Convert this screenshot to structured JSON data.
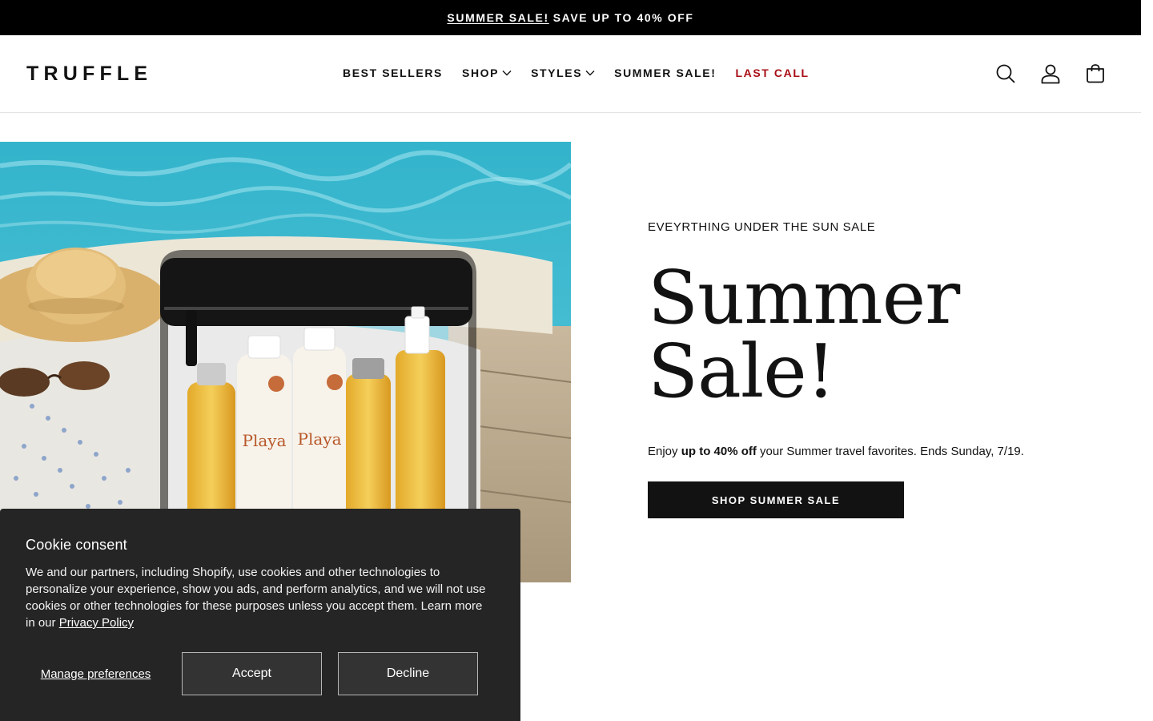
{
  "announcement": {
    "link_text": "SUMMER SALE!",
    "text": "SAVE UP TO 40% OFF"
  },
  "header": {
    "logo": "TRUFFLE",
    "nav": [
      {
        "label": "BEST SELLERS"
      },
      {
        "label": "SHOP"
      },
      {
        "label": "STYLES"
      },
      {
        "label": "SUMMER SALE!"
      },
      {
        "label": "LAST CALL"
      }
    ],
    "icons": [
      "search-icon",
      "account-icon",
      "cart-icon"
    ]
  },
  "hero": {
    "eyebrow": "EVEYRTHING UNDER THE SUN SALE",
    "title": "Summer Sale!",
    "desc_pre": "Enjoy ",
    "desc_bold": "up to 40% off",
    "desc_post": " your Summer travel favorites. Ends Sunday, 7/19.",
    "cta": "SHOP SUMMER SALE",
    "image_product_label_1": "Playa",
    "image_product_label_2": "Playa"
  },
  "cookie": {
    "title": "Cookie consent",
    "body": "We and our partners, including Shopify, use cookies and other technologies to personalize your experience, show you ads, and perform analytics, and we will not use cookies or other technologies for these purposes unless you accept them. Learn more in our ",
    "privacy_link": "Privacy Policy",
    "manage": "Manage preferences",
    "accept": "Accept",
    "decline": "Decline"
  },
  "colors": {
    "announcement_bg": "#000000",
    "text": "#121212",
    "last_call": "#a80d14",
    "cookie_bg": "#252525"
  }
}
